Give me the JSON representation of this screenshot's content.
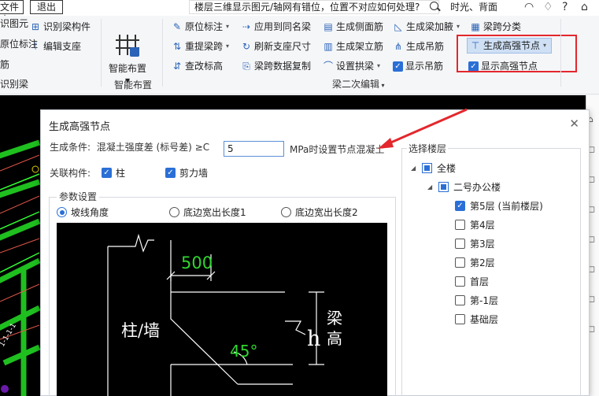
{
  "topbar": {
    "folder_label": "文件夹",
    "exit_label": "退出",
    "search_text": "楼层三维显示图元/轴网有错位，位置不对应如何处理?",
    "user_link": "时光、背面"
  },
  "ribbon": {
    "left_col": [
      "识图元",
      "识别梁构件",
      "编辑支座",
      "原位标注",
      "识别梁"
    ],
    "smart_layout_label": "智能布置",
    "smart_layout_group": "智能布置",
    "mid_items": [
      {
        "label": "原位标注",
        "icon": "annotation-icon",
        "dropdown": true
      },
      {
        "label": "应用到同名梁",
        "icon": "apply-icon",
        "dropdown": false
      },
      {
        "label": "生成侧面筋",
        "icon": "side-rebar-icon",
        "dropdown": false
      },
      {
        "label": "生成梁加腋",
        "icon": "haunch-icon",
        "dropdown": true
      },
      {
        "label": "梁跨分类",
        "icon": "span-class-icon",
        "dropdown": false
      },
      {
        "label": "重提梁跨",
        "icon": "re-extract-icon",
        "dropdown": true
      },
      {
        "label": "刷新支座尺寸",
        "icon": "refresh-icon",
        "dropdown": false
      },
      {
        "label": "生成架立筋",
        "icon": "erect-rebar-icon",
        "dropdown": false
      },
      {
        "label": "生成吊筋",
        "icon": "hanger-icon",
        "dropdown": false
      },
      {
        "label": "生成高强节点",
        "icon": "high-strength-icon",
        "dropdown": true
      },
      {
        "label": "查改标高",
        "icon": "elevation-icon",
        "dropdown": false
      },
      {
        "label": "梁跨数据复制",
        "icon": "copy-icon",
        "dropdown": false
      },
      {
        "label": "设置拱梁",
        "icon": "arch-icon",
        "dropdown": true
      },
      {
        "label": "显示吊筋",
        "icon": "checkbox",
        "dropdown": false
      },
      {
        "label": "显示高强节点",
        "icon": "checkbox",
        "dropdown": false
      }
    ],
    "group_label_beam2": "梁二次编辑"
  },
  "dialog": {
    "title": "生成高强节点",
    "cond_label": "生成条件:",
    "cond_text": "混凝土强度差 (标号差) ≥C",
    "cond_value": "5",
    "cond_suffix": "MPa时设置节点混凝土",
    "rel_label": "关联构件:",
    "rel_column": "柱",
    "rel_shearwall": "剪力墙",
    "params_label": "参数设置",
    "radio_1": "坡线角度",
    "radio_2": "底边宽出长度1",
    "radio_3": "底边宽出长度2",
    "preview": {
      "dim_500": "500",
      "col_wall": "柱/墙",
      "angle": "45°",
      "h": "h",
      "beam_height_1": "梁",
      "beam_height_2": "高"
    },
    "floors_label": "选择楼层",
    "tree": [
      {
        "label": "全楼",
        "level": 0,
        "state": "partial"
      },
      {
        "label": "二号办公楼",
        "level": 1,
        "state": "partial"
      },
      {
        "label": "第5层 (当前楼层)",
        "level": 2,
        "state": "checked"
      },
      {
        "label": "第4层",
        "level": 2,
        "state": "unchecked"
      },
      {
        "label": "第3层",
        "level": 2,
        "state": "unchecked"
      },
      {
        "label": "第2层",
        "level": 2,
        "state": "unchecked"
      },
      {
        "label": "首层",
        "level": 2,
        "state": "unchecked"
      },
      {
        "label": "第-1层",
        "level": 2,
        "state": "unchecked"
      },
      {
        "label": "基础层",
        "level": 2,
        "state": "unchecked"
      }
    ]
  },
  "colors": {
    "accent": "#2a6fd6",
    "highlight_box": "#e3272d",
    "cad_bg": "#000000",
    "cad_green": "#2fd62f"
  }
}
